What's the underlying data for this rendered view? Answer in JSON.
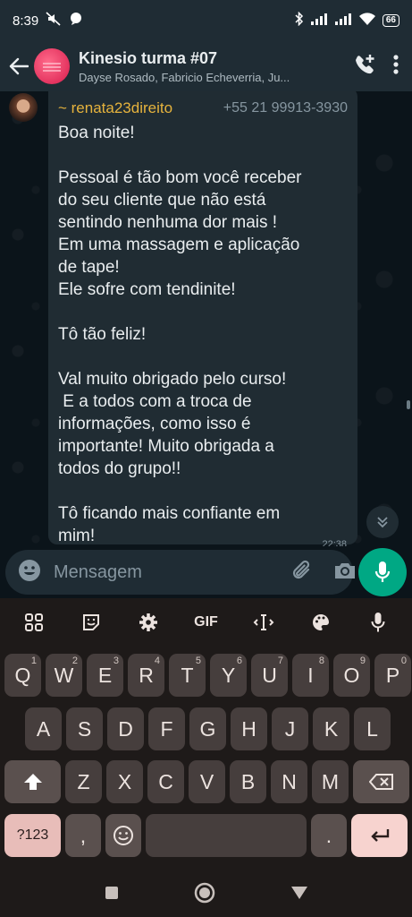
{
  "status_bar": {
    "time": "8:39",
    "battery": "66"
  },
  "header": {
    "title": "Kinesio turma #07",
    "members": "Dayse Rosado, Fabricio Echeverria, Ju..."
  },
  "message": {
    "sender_name": "~ renata23direito",
    "sender_phone": "+55 21 99913-3930",
    "lines": [
      "Boa noite!",
      "",
      "Pessoal é tão bom você receber",
      "do seu cliente que não está",
      "sentindo nenhuma dor mais !",
      "Em uma massagem e aplicação",
      "de tape!",
      "Ele sofre com tendinite!",
      "",
      "Tô tão feliz!",
      "",
      "Val muito obrigado pelo curso!",
      " E a todos com a troca de",
      "informações, como isso é",
      "importante! Muito obrigada a",
      "todos do grupo!!",
      "",
      "Tô ficando mais confiante em",
      "mim!"
    ],
    "time": "22:38"
  },
  "composer": {
    "placeholder": "Mensagem"
  },
  "keyboard": {
    "toolbar": {
      "gif_label": "GIF"
    },
    "row1": [
      {
        "k": "Q",
        "h": "1"
      },
      {
        "k": "W",
        "h": "2"
      },
      {
        "k": "E",
        "h": "3"
      },
      {
        "k": "R",
        "h": "4"
      },
      {
        "k": "T",
        "h": "5"
      },
      {
        "k": "Y",
        "h": "6"
      },
      {
        "k": "U",
        "h": "7"
      },
      {
        "k": "I",
        "h": "8"
      },
      {
        "k": "O",
        "h": "9"
      },
      {
        "k": "P",
        "h": "0"
      }
    ],
    "row2": [
      "A",
      "S",
      "D",
      "F",
      "G",
      "H",
      "J",
      "K",
      "L"
    ],
    "row3": [
      "Z",
      "X",
      "C",
      "V",
      "B",
      "N",
      "M"
    ],
    "symbols_label": "?123",
    "comma_label": ",",
    "period_label": "."
  },
  "colors": {
    "accent": "#00a884",
    "sender_name": "#e6b33d",
    "bubble": "#202c33"
  }
}
